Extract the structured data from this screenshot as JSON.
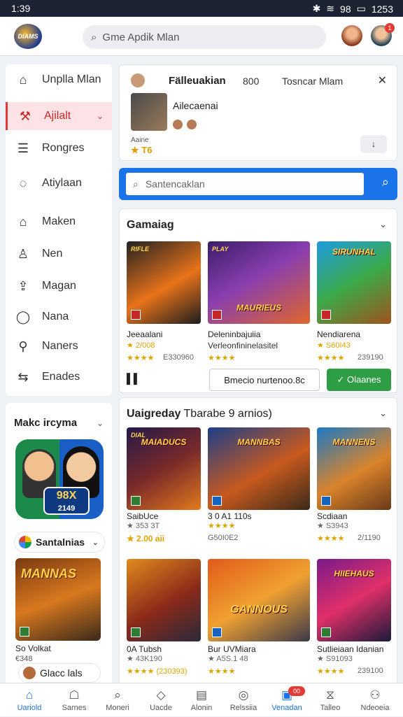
{
  "status": {
    "time": "1:39",
    "signal": "98",
    "battery": "1253"
  },
  "header": {
    "logo_text": "DIAMS",
    "search_placeholder": "Gme Apdik Mlan"
  },
  "sidebar": {
    "items": [
      {
        "label": "Unplla Mlan",
        "icon": "home-icon"
      },
      {
        "label": "Ajilalt",
        "icon": "tools-icon",
        "active": true
      },
      {
        "label": "Rongres",
        "icon": "list-icon"
      },
      {
        "label": "Atiylaan",
        "icon": "chat-icon"
      },
      {
        "label": "Maken",
        "icon": "box-icon"
      },
      {
        "label": "Nen",
        "icon": "user-icon"
      },
      {
        "label": "Magan",
        "icon": "upload-icon"
      },
      {
        "label": "Nana",
        "icon": "bubble-icon"
      },
      {
        "label": "Naners",
        "icon": "pin-icon"
      },
      {
        "label": "Enades",
        "icon": "share-icon"
      }
    ]
  },
  "side_panel": {
    "title": "Makc ircyma",
    "hero_score": "98X",
    "hero_sub": "2149",
    "chip_label": "Santalnias",
    "card_title": "MANNAS",
    "card_name": "So Volkat",
    "card_price": "€348",
    "button_label": "Glacc lals"
  },
  "top_card": {
    "title": "Fälleuakian",
    "number": "800",
    "link": "Tosncar Mlam",
    "subtitle": "Ailecaenai",
    "meta": "Aaine",
    "rating": "★ T6",
    "btn": "↓"
  },
  "search_bar": {
    "placeholder": "Santencaklan"
  },
  "section1": {
    "title": "Gamaiag",
    "games": [
      {
        "card_title": "RIFLE",
        "big": "",
        "name": "Jeeaalani",
        "stars": "★ 2/008",
        "meta": "★★★★",
        "meta2": "E330960"
      },
      {
        "card_title": "PLAY",
        "big": "MAURIEUS",
        "name": "Deleninbajuiia",
        "stars": "Verleonfininelasitel",
        "meta": "★★★★",
        "meta2": ""
      },
      {
        "card_title": "",
        "big": "SIRUNHAL",
        "name": "Nendiarena",
        "stars": "★ S60I43",
        "meta": "★★★★",
        "meta2": "239190"
      }
    ],
    "list_icon": "▌▌",
    "outline_btn": "Bmecio nurtenoo.8c",
    "green_btn": "✓ Olaanes"
  },
  "section2": {
    "title": "Uaigreday",
    "title_suffix": "Tbarabe 9 arnios)",
    "games": [
      {
        "card_title": "DIAL",
        "big": "MAIADUCS",
        "name": "SaibUce",
        "stars": "★ 353 3T",
        "meta": "★ 2.00 aii",
        "meta2": ""
      },
      {
        "card_title": "",
        "big": "MANNBAS",
        "name": "3 0 A1 110s",
        "stars": "★★★★",
        "meta": "G50I0E2",
        "meta2": ""
      },
      {
        "card_title": "",
        "big": "MANNENS",
        "name": "Scdiaan",
        "stars": "★ S3943",
        "meta": "★★★★",
        "meta2": "2/1190"
      },
      {
        "card_title": "",
        "big": "",
        "name": "0A Tubsh",
        "stars": "★ 43K190",
        "meta": "★★★★ (230393)",
        "meta2": ""
      },
      {
        "card_title": "",
        "big": "GANNOUS",
        "name": "Bur UVMiara",
        "stars": "★ A5S.1 48",
        "meta": "★★★★",
        "meta2": ""
      },
      {
        "card_title": "",
        "big": "HIIEHAUS",
        "name": "Sutlieiaan Idanian",
        "stars": "★ S91093",
        "meta": "★★★★",
        "meta2": "239100"
      }
    ]
  },
  "bottom_nav": [
    {
      "label": "Uariold",
      "icon": "⌂",
      "active": true
    },
    {
      "label": "Sarnes",
      "icon": "☖"
    },
    {
      "label": "Moneri",
      "icon": "⌕"
    },
    {
      "label": "Uacde",
      "icon": "◇"
    },
    {
      "label": "Alonin",
      "icon": "▤"
    },
    {
      "label": "Relssiia",
      "icon": "◎"
    },
    {
      "label": "Venadan",
      "icon": "▣",
      "badge": "00"
    },
    {
      "label": "Talleo",
      "icon": "⧖"
    },
    {
      "label": "Ndeoeia",
      "icon": "⚇"
    }
  ]
}
